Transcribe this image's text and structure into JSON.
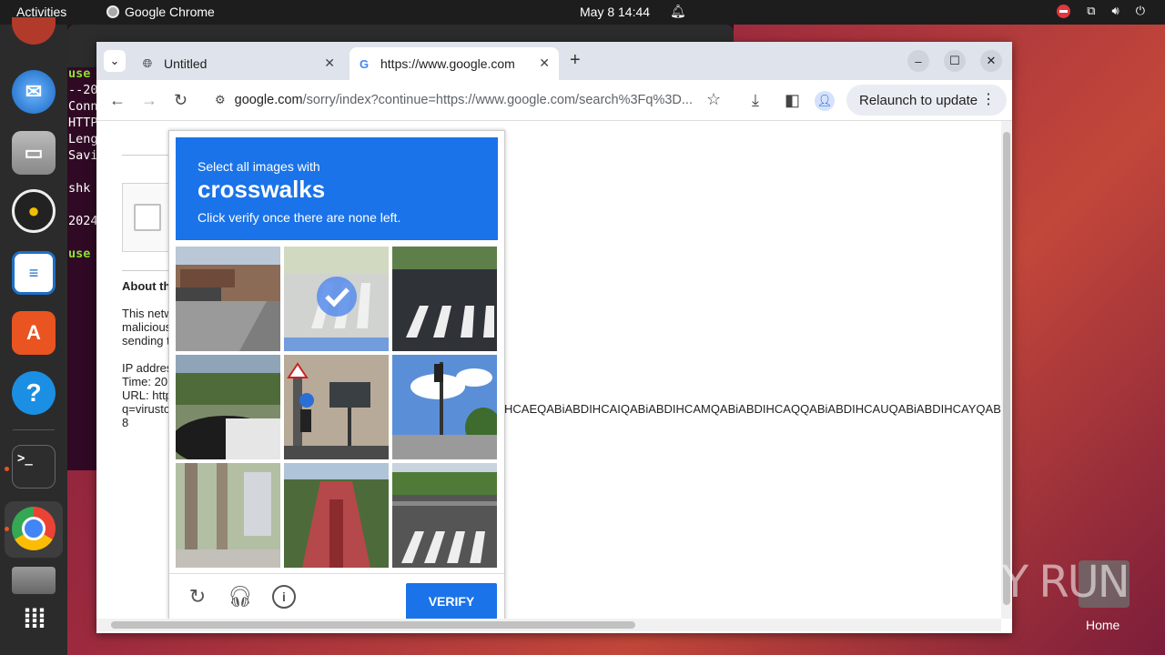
{
  "topbar": {
    "activities": "Activities",
    "app_name": "Google Chrome",
    "clock": "May 8  14:44"
  },
  "terminal": {
    "lines": [
      "use",
      "--20",
      "Conn",
      "HTTP",
      "Leng",
      "Savi",
      "",
      "shk",
      "",
      "2024",
      "",
      "use"
    ]
  },
  "chrome": {
    "tabs": [
      {
        "title": "Untitled"
      },
      {
        "title": "https://www.google.com"
      }
    ],
    "url_host": "google.com",
    "url_path": "/sorry/index?continue=https://www.google.com/search%3Fq%3D...",
    "relaunch_label": "Relaunch to update"
  },
  "page": {
    "about": "About th",
    "para1": [
      "This netw",
      "malicious",
      "sending t"
    ],
    "ip": "IP addres",
    "time": "Time: 20",
    "url": "URL: http",
    "q": "q=virusto",
    "q_tail": "HCAEQABiABDIHCAIQABiABDIHCAMQABiABDIHCAQQABiABDIHCAUQABiABDIHCAYQAB",
    "eight": "8"
  },
  "captcha": {
    "line1": "Select all images with",
    "keyword": "crosswalks",
    "line3": "Click verify once there are none left.",
    "verify_label": "VERIFY",
    "selected_tile": 2
  },
  "desktop": {
    "watermark": "ANY RUN",
    "home_label": "Home"
  }
}
